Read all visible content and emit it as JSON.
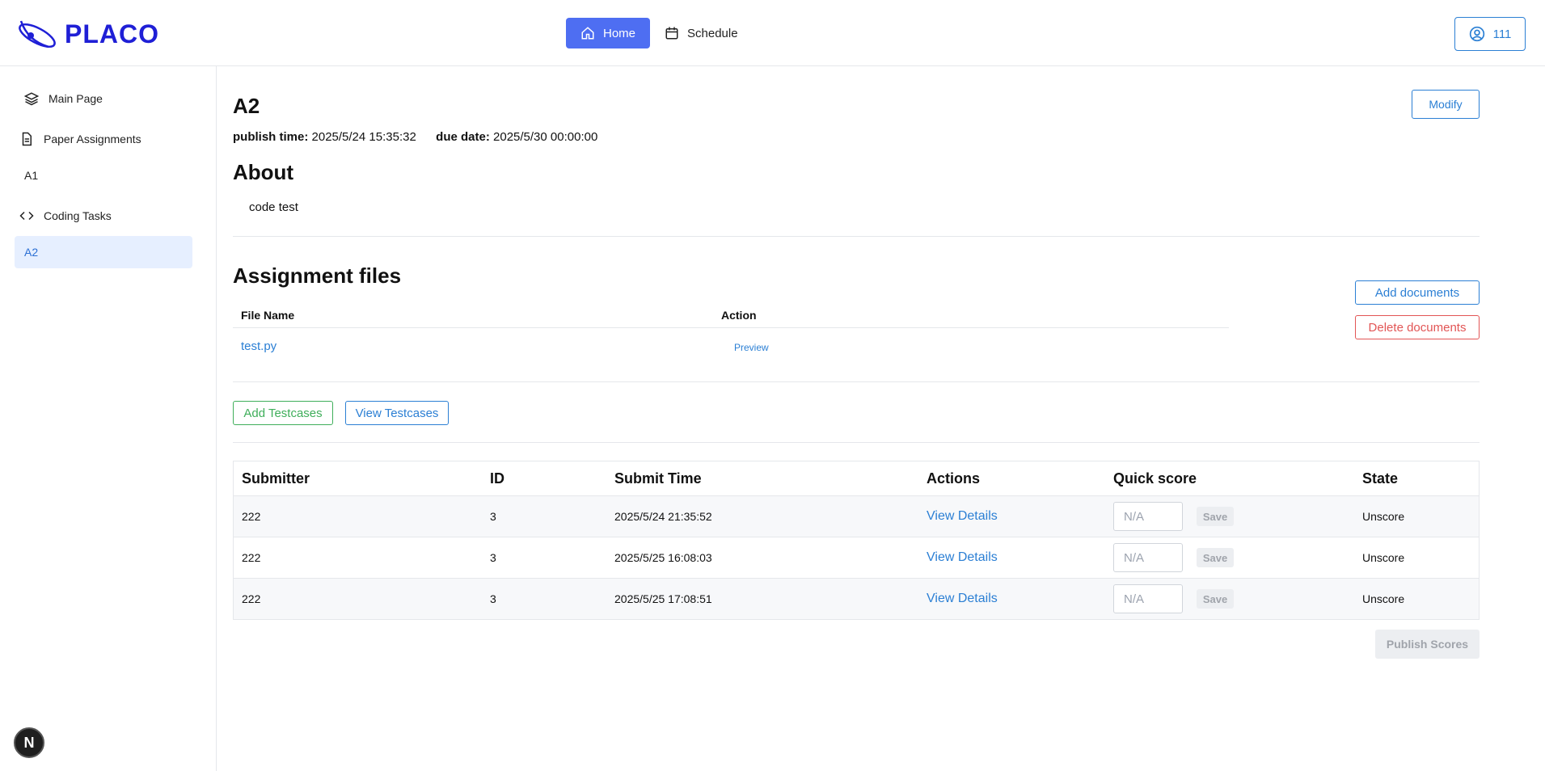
{
  "app": {
    "name": "PLACO"
  },
  "nav": {
    "home": "Home",
    "schedule": "Schedule"
  },
  "user": {
    "label": "111"
  },
  "sidebar": {
    "items": [
      {
        "label": "Main Page"
      },
      {
        "label": "Paper Assignments"
      },
      {
        "label": "A1"
      },
      {
        "label": "Coding Tasks"
      },
      {
        "label": "A2"
      }
    ]
  },
  "assignment": {
    "title": "A2",
    "modify_label": "Modify",
    "publish_label": "publish time:",
    "publish_time": "2025/5/24 15:35:32",
    "due_label": "due date:",
    "due_date": "2025/5/30 00:00:00",
    "about_heading": "About",
    "about_text": "code test"
  },
  "files": {
    "heading": "Assignment files",
    "col_name": "File Name",
    "col_action": "Action",
    "rows": [
      {
        "name": "test.py",
        "action": "Preview"
      }
    ],
    "add_label": "Add documents",
    "delete_label": "Delete documents"
  },
  "testcases": {
    "add_label": "Add Testcases",
    "view_label": "View Testcases"
  },
  "submissions": {
    "headers": {
      "submitter": "Submitter",
      "id": "ID",
      "submit_time": "Submit Time",
      "actions": "Actions",
      "quick_score": "Quick score",
      "state": "State"
    },
    "rows": [
      {
        "submitter": "222",
        "id": "3",
        "time": "2025/5/24 21:35:52",
        "action": "View Details",
        "score_placeholder": "N/A",
        "save": "Save",
        "state": "Unscore"
      },
      {
        "submitter": "222",
        "id": "3",
        "time": "2025/5/25 16:08:03",
        "action": "View Details",
        "score_placeholder": "N/A",
        "save": "Save",
        "state": "Unscore"
      },
      {
        "submitter": "222",
        "id": "3",
        "time": "2025/5/25 17:08:51",
        "action": "View Details",
        "score_placeholder": "N/A",
        "save": "Save",
        "state": "Unscore"
      }
    ],
    "publish_label": "Publish Scores"
  },
  "badge": {
    "letter": "N"
  },
  "colors": {
    "primary": "#2b7fd4",
    "nav_active": "#4e6ef2",
    "success": "#3fae5a",
    "danger": "#e25555",
    "logo": "#1f1fd6"
  }
}
